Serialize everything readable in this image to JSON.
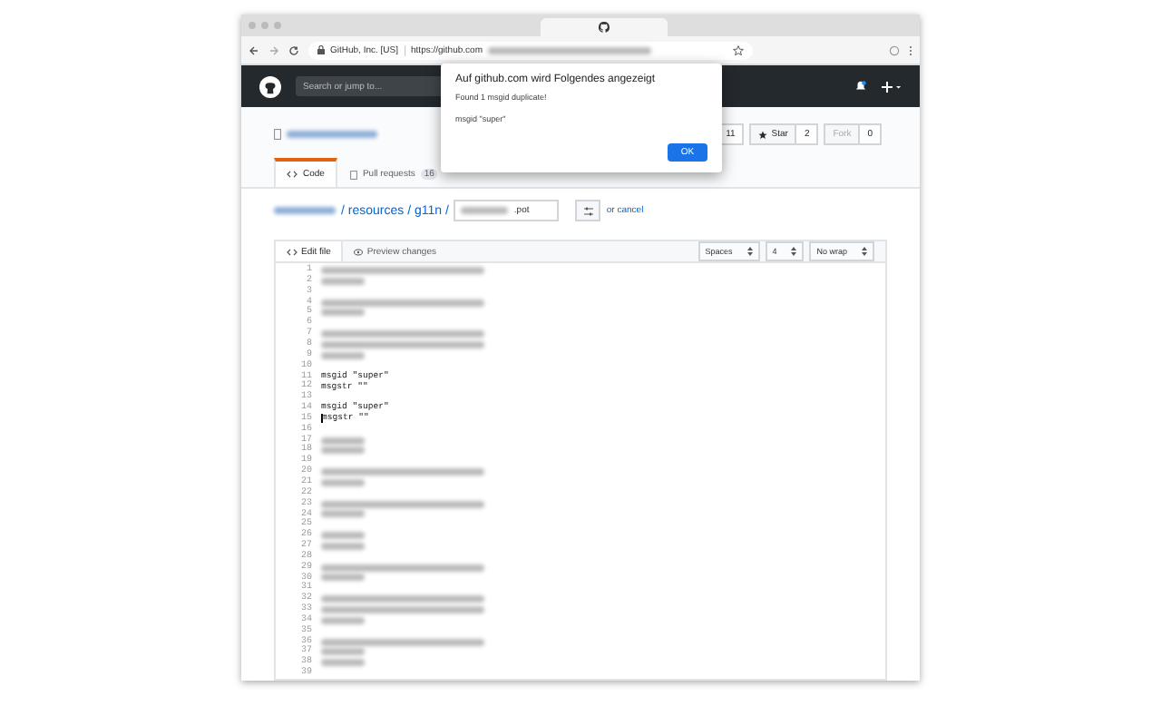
{
  "browser": {
    "site_info": "GitHub, Inc. [US]",
    "url": "https://github.com"
  },
  "header": {
    "search": {
      "placeholder": "Search or jump to..."
    }
  },
  "repo": {
    "actions": [
      {
        "label": "11",
        "kind": "count"
      },
      {
        "label": "Star",
        "kind": "button"
      },
      {
        "label": "2",
        "kind": "count"
      },
      {
        "label": "Fork",
        "kind": "disabled"
      },
      {
        "label": "0",
        "kind": "count"
      }
    ],
    "tabs": [
      {
        "label": "Code",
        "selected": true
      },
      {
        "label": "Pull requests",
        "count": "16",
        "selected": false
      }
    ]
  },
  "breadcrumb": {
    "path": "/ resources / g11n /",
    "filename_suffix": ".pot",
    "cancel": "or cancel"
  },
  "editor": {
    "tabs": [
      {
        "label": "Edit file",
        "selected": true
      },
      {
        "label": "Preview changes",
        "selected": false
      }
    ],
    "selects": [
      "Spaces",
      "4",
      "No wrap"
    ],
    "lines": [
      {
        "number": "1",
        "kind": "long",
        "cursor": false
      },
      {
        "number": "2",
        "kind": "short",
        "cursor": false
      },
      {
        "number": "3",
        "kind": "empty",
        "cursor": false
      },
      {
        "number": "4",
        "kind": "long",
        "cursor": false
      },
      {
        "number": "5",
        "kind": "short",
        "cursor": false
      },
      {
        "number": "6",
        "kind": "empty",
        "cursor": false
      },
      {
        "number": "7",
        "kind": "long",
        "cursor": false
      },
      {
        "number": "8",
        "kind": "long",
        "cursor": false
      },
      {
        "number": "9",
        "kind": "short",
        "cursor": false
      },
      {
        "number": "10",
        "kind": "empty",
        "cursor": false
      },
      {
        "number": "11",
        "kind": "text",
        "text": "msgid \"super\"",
        "cursor": false
      },
      {
        "number": "12",
        "kind": "text",
        "text": "msgstr \"\"",
        "cursor": false
      },
      {
        "number": "13",
        "kind": "empty",
        "cursor": false
      },
      {
        "number": "14",
        "kind": "text",
        "text": "msgid \"super\"",
        "cursor": false
      },
      {
        "number": "15",
        "kind": "text",
        "text": "msgstr \"\"",
        "cursor": true
      },
      {
        "number": "16",
        "kind": "empty",
        "cursor": false
      },
      {
        "number": "17",
        "kind": "short",
        "cursor": false
      },
      {
        "number": "18",
        "kind": "short",
        "cursor": false
      },
      {
        "number": "19",
        "kind": "empty",
        "cursor": false
      },
      {
        "number": "20",
        "kind": "long",
        "cursor": false
      },
      {
        "number": "21",
        "kind": "short",
        "cursor": false
      },
      {
        "number": "22",
        "kind": "empty",
        "cursor": false
      },
      {
        "number": "23",
        "kind": "long",
        "cursor": false
      },
      {
        "number": "24",
        "kind": "short",
        "cursor": false
      },
      {
        "number": "25",
        "kind": "empty",
        "cursor": false
      },
      {
        "number": "26",
        "kind": "short",
        "cursor": false
      },
      {
        "number": "27",
        "kind": "short",
        "cursor": false
      },
      {
        "number": "28",
        "kind": "empty",
        "cursor": false
      },
      {
        "number": "29",
        "kind": "long",
        "cursor": false
      },
      {
        "number": "30",
        "kind": "short",
        "cursor": false
      },
      {
        "number": "31",
        "kind": "empty",
        "cursor": false
      },
      {
        "number": "32",
        "kind": "long",
        "cursor": false
      },
      {
        "number": "33",
        "kind": "long",
        "cursor": false
      },
      {
        "number": "34",
        "kind": "short",
        "cursor": false
      },
      {
        "number": "35",
        "kind": "empty",
        "cursor": false
      },
      {
        "number": "36",
        "kind": "long",
        "cursor": false
      },
      {
        "number": "37",
        "kind": "short",
        "cursor": false
      },
      {
        "number": "38",
        "kind": "short",
        "cursor": false
      },
      {
        "number": "39",
        "kind": "empty",
        "cursor": false
      }
    ]
  },
  "dialog": {
    "title": "Auf github.com wird Folgendes angezeigt",
    "message": "Found 1 msgid duplicate!",
    "detail": "msgid \"super\"",
    "button": "OK"
  }
}
